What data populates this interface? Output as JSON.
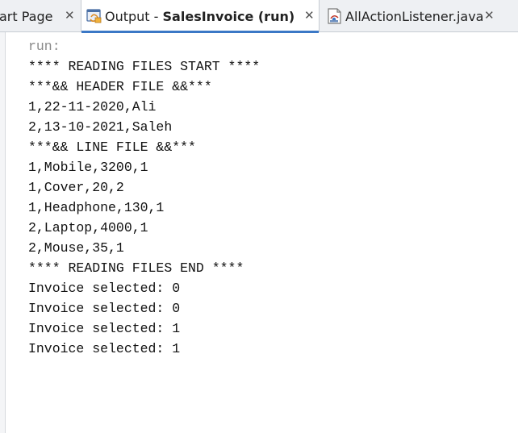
{
  "tabs": [
    {
      "label": "art Page",
      "bold": "",
      "close": "✕"
    },
    {
      "label": "Output - ",
      "bold": "SalesInvoice (run)",
      "close": "✕"
    },
    {
      "label": "AllActionListener.java",
      "bold": "",
      "close": "✕"
    }
  ],
  "icons": {
    "output_tab": "output-console-icon",
    "java_tab": "java-file-icon"
  },
  "colors": {
    "active_tab_underline": "#3b78c6",
    "run_text": "#8a8a8a"
  },
  "console": {
    "lines": [
      "run:",
      "**** READING FILES START ****",
      "***&& HEADER FILE &&***",
      "1,22-11-2020,Ali",
      "2,13-10-2021,Saleh",
      "***&& LINE FILE &&***",
      "1,Mobile,3200,1",
      "1,Cover,20,2",
      "1,Headphone,130,1",
      "2,Laptop,4000,1",
      "2,Mouse,35,1",
      "**** READING FILES END ****",
      "Invoice selected: 0",
      "Invoice selected: 0",
      "Invoice selected: 1",
      "Invoice selected: 1"
    ]
  }
}
